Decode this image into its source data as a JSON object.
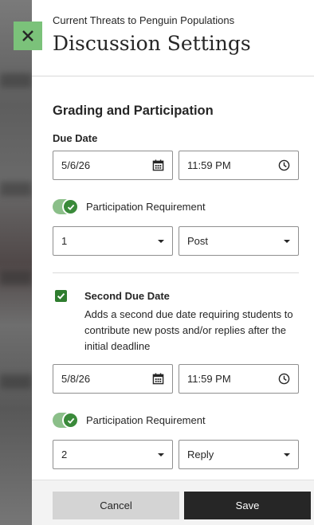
{
  "backdrop": {},
  "close_button": {
    "icon": "close-icon"
  },
  "header": {
    "subtitle": "Current Threats to Penguin Populations",
    "title": "Discussion Settings"
  },
  "grading": {
    "section_title": "Grading and Participation",
    "due_date_label": "Due Date",
    "due_date": {
      "date": "5/6/26",
      "time": "11:59 PM"
    },
    "participation_1": {
      "label": "Participation Requirement",
      "enabled": true,
      "count": "1",
      "type": "Post"
    },
    "second_due_date": {
      "checked": true,
      "title": "Second Due Date",
      "description": "Adds a second due date requiring students to contribute new posts and/or replies after the initial deadline",
      "date": "5/8/26",
      "time": "11:59 PM"
    },
    "participation_2": {
      "label": "Participation Requirement",
      "enabled": true,
      "count": "2",
      "type": "Reply"
    }
  },
  "footer": {
    "cancel_label": "Cancel",
    "save_label": "Save"
  },
  "colors": {
    "accent_green": "#3a8a3a",
    "close_bg": "#7bc27a",
    "save_bg": "#262626",
    "cancel_bg": "#d4d4d4"
  }
}
